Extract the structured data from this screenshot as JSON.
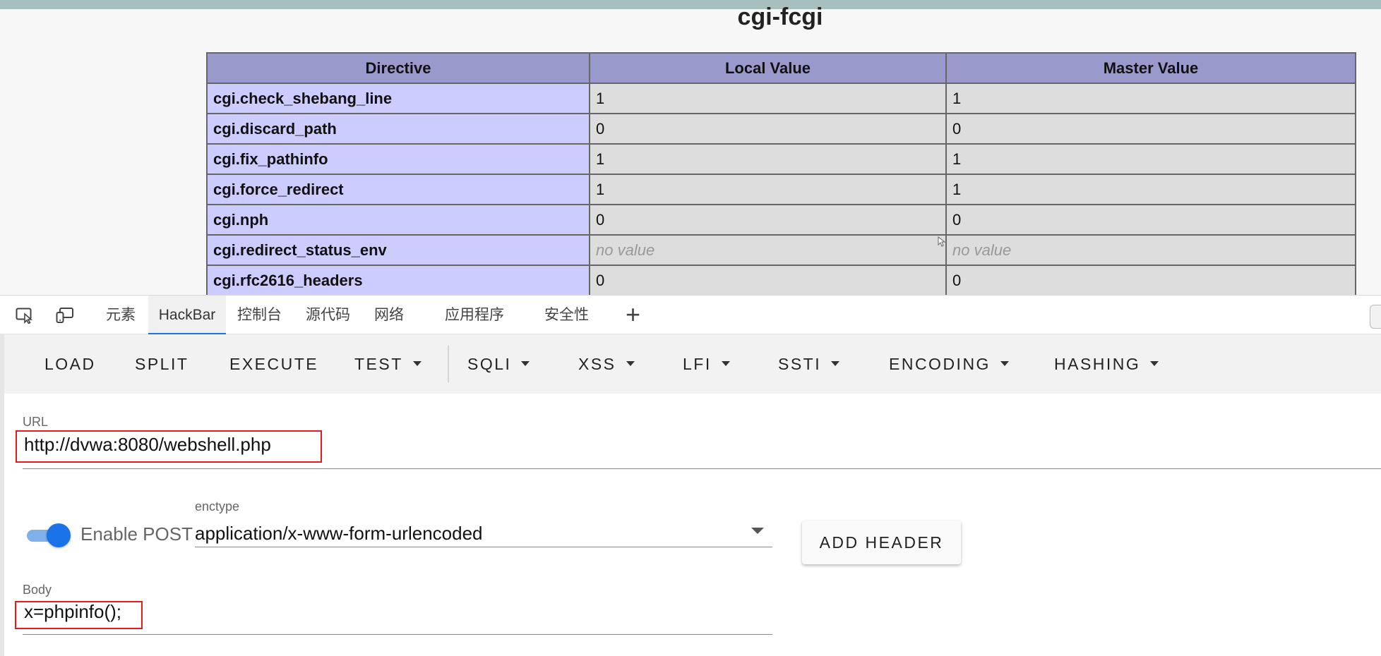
{
  "page": {
    "section_title": "cgi-fcgi",
    "table": {
      "headers": [
        "Directive",
        "Local Value",
        "Master Value"
      ],
      "rows": [
        {
          "directive": "cgi.check_shebang_line",
          "local": "1",
          "master": "1"
        },
        {
          "directive": "cgi.discard_path",
          "local": "0",
          "master": "0"
        },
        {
          "directive": "cgi.fix_pathinfo",
          "local": "1",
          "master": "1"
        },
        {
          "directive": "cgi.force_redirect",
          "local": "1",
          "master": "1"
        },
        {
          "directive": "cgi.nph",
          "local": "0",
          "master": "0"
        },
        {
          "directive": "cgi.redirect_status_env",
          "local": "no value",
          "master": "no value"
        },
        {
          "directive": "cgi.rfc2616_headers",
          "local": "0",
          "master": "0"
        }
      ]
    }
  },
  "devtools": {
    "tabs": [
      "元素",
      "HackBar",
      "控制台",
      "源代码",
      "网络",
      "应用程序",
      "安全性"
    ],
    "active_tab": "HackBar",
    "add_tab_label": "+"
  },
  "toolbar": {
    "load": "LOAD",
    "split": "SPLIT",
    "execute": "EXECUTE",
    "test": "TEST",
    "sqli": "SQLI",
    "xss": "XSS",
    "lfi": "LFI",
    "ssti": "SSTI",
    "encoding": "ENCODING",
    "hashing": "HASHING"
  },
  "form": {
    "url_label": "URL",
    "url_value": "http://dvwa:8080/webshell.php",
    "enable_post_label": "Enable POST",
    "enable_post_on": true,
    "enctype_label": "enctype",
    "enctype_value": "application/x-www-form-urlencoded",
    "add_header_label": "ADD HEADER",
    "body_label": "Body",
    "body_value": "x=phpinfo();"
  },
  "colors": {
    "table_header": "#9999cc",
    "directive_cell": "#ccccff",
    "value_cell": "#dddddd",
    "accent": "#1a73e8",
    "highlight_box": "#e8191d"
  }
}
